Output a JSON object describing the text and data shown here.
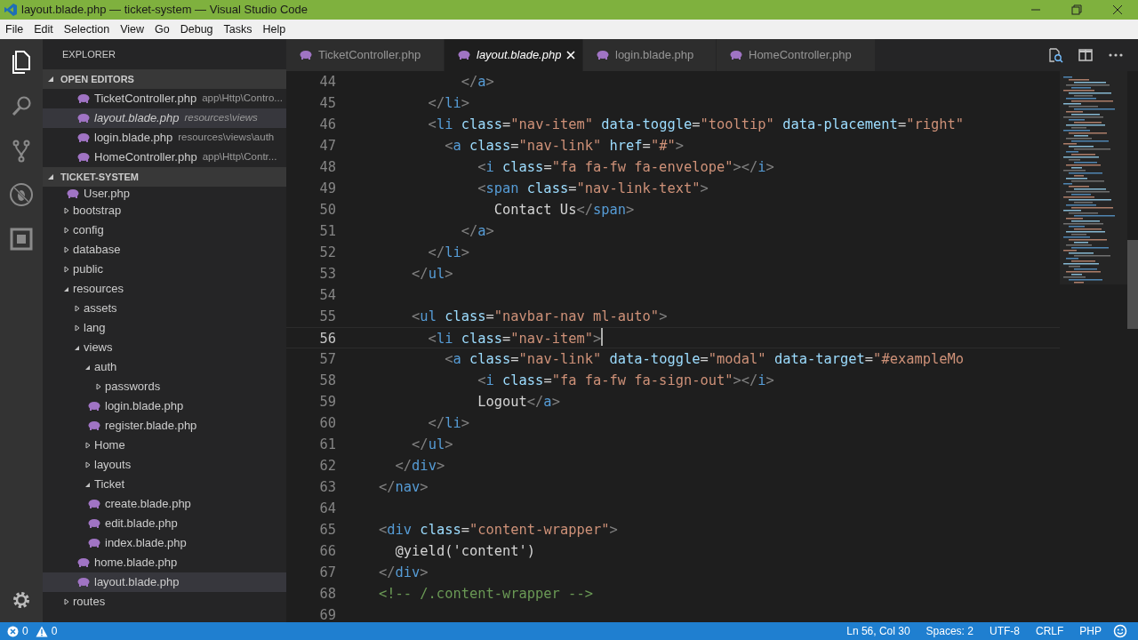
{
  "window": {
    "title": "layout.blade.php — ticket-system — Visual Studio Code"
  },
  "menu": [
    "File",
    "Edit",
    "Selection",
    "View",
    "Go",
    "Debug",
    "Tasks",
    "Help"
  ],
  "activity_bar": [
    {
      "kind": "files",
      "selected": true
    },
    {
      "kind": "search",
      "selected": false
    },
    {
      "kind": "git",
      "selected": false
    },
    {
      "kind": "debug",
      "selected": false
    },
    {
      "kind": "extensions",
      "selected": false
    }
  ],
  "sidebar": {
    "title": "EXPLORER",
    "open_editors": {
      "title": "OPEN EDITORS",
      "expanded": true,
      "items": [
        {
          "name": "TicketController.php",
          "description": "app\\Http\\Contro...",
          "selected": false,
          "preview": false
        },
        {
          "name": "layout.blade.php",
          "description": "resources\\views",
          "selected": true,
          "preview": true
        },
        {
          "name": "login.blade.php",
          "description": "resources\\views\\auth",
          "selected": false,
          "preview": false
        },
        {
          "name": "HomeController.php",
          "description": "app\\Http\\Contr...",
          "selected": false,
          "preview": false
        }
      ]
    },
    "project": {
      "title": "TICKET-SYSTEM",
      "expanded": true,
      "partial_item": "User.php",
      "tree": [
        {
          "name": "bootstrap",
          "kind": "folder",
          "expanded": false,
          "selected": false
        },
        {
          "name": "config",
          "kind": "folder",
          "expanded": false,
          "selected": false
        },
        {
          "name": "database",
          "kind": "folder",
          "expanded": false,
          "selected": false
        },
        {
          "name": "public",
          "kind": "folder",
          "expanded": false,
          "selected": false
        },
        {
          "name": "resources",
          "kind": "folder",
          "expanded": true,
          "selected": false,
          "children": [
            {
              "name": "assets",
              "kind": "folder",
              "expanded": false,
              "selected": false
            },
            {
              "name": "lang",
              "kind": "folder",
              "expanded": false,
              "selected": false
            },
            {
              "name": "views",
              "kind": "folder",
              "expanded": true,
              "selected": false,
              "children": [
                {
                  "name": "auth",
                  "kind": "folder",
                  "expanded": true,
                  "selected": false,
                  "children": [
                    {
                      "name": "passwords",
                      "kind": "folder",
                      "expanded": false,
                      "selected": false
                    },
                    {
                      "name": "login.blade.php",
                      "kind": "file",
                      "selected": false
                    },
                    {
                      "name": "register.blade.php",
                      "kind": "file",
                      "selected": false
                    }
                  ]
                },
                {
                  "name": "Home",
                  "kind": "folder",
                  "expanded": false,
                  "selected": false
                },
                {
                  "name": "layouts",
                  "kind": "folder",
                  "expanded": false,
                  "selected": false
                },
                {
                  "name": "Ticket",
                  "kind": "folder",
                  "expanded": true,
                  "selected": false,
                  "children": [
                    {
                      "name": "create.blade.php",
                      "kind": "file",
                      "selected": false
                    },
                    {
                      "name": "edit.blade.php",
                      "kind": "file",
                      "selected": false
                    },
                    {
                      "name": "index.blade.php",
                      "kind": "file",
                      "selected": false
                    }
                  ]
                },
                {
                  "name": "home.blade.php",
                  "kind": "file",
                  "selected": false
                },
                {
                  "name": "layout.blade.php",
                  "kind": "file",
                  "selected": true
                }
              ]
            }
          ]
        },
        {
          "name": "routes",
          "kind": "folder",
          "expanded": false,
          "selected": false
        }
      ]
    }
  },
  "tabs": [
    {
      "label": "TicketController.php",
      "selected": false,
      "preview": false
    },
    {
      "label": "layout.blade.php",
      "selected": true,
      "preview": true
    },
    {
      "label": "login.blade.php",
      "selected": false,
      "preview": false
    },
    {
      "label": "HomeController.php",
      "selected": false,
      "preview": false
    }
  ],
  "editor": {
    "lines": [
      {
        "number": "44",
        "cursor": false,
        "tokens": [
          {
            "kind": "punct",
            "text": "          </"
          },
          {
            "kind": "tag",
            "text": "a"
          },
          {
            "kind": "punct",
            "text": ">"
          }
        ]
      },
      {
        "number": "45",
        "cursor": false,
        "tokens": [
          {
            "kind": "punct",
            "text": "      </"
          },
          {
            "kind": "tag",
            "text": "li"
          },
          {
            "kind": "punct",
            "text": ">"
          }
        ]
      },
      {
        "number": "46",
        "cursor": false,
        "tokens": [
          {
            "kind": "punct",
            "text": "      <"
          },
          {
            "kind": "tag",
            "text": "li"
          },
          {
            "kind": "attr",
            "text": " class"
          },
          {
            "kind": "text",
            "text": "="
          },
          {
            "kind": "string",
            "text": "\"nav-item\""
          },
          {
            "kind": "attr",
            "text": " data-toggle"
          },
          {
            "kind": "text",
            "text": "="
          },
          {
            "kind": "string",
            "text": "\"tooltip\""
          },
          {
            "kind": "attr",
            "text": " data-placement"
          },
          {
            "kind": "text",
            "text": "="
          },
          {
            "kind": "string",
            "text": "\"right\""
          }
        ]
      },
      {
        "number": "47",
        "cursor": false,
        "tokens": [
          {
            "kind": "punct",
            "text": "        <"
          },
          {
            "kind": "tag",
            "text": "a"
          },
          {
            "kind": "attr",
            "text": " class"
          },
          {
            "kind": "text",
            "text": "="
          },
          {
            "kind": "string",
            "text": "\"nav-link\""
          },
          {
            "kind": "attr",
            "text": " href"
          },
          {
            "kind": "text",
            "text": "="
          },
          {
            "kind": "string",
            "text": "\"#\""
          },
          {
            "kind": "punct",
            "text": ">"
          }
        ]
      },
      {
        "number": "48",
        "cursor": false,
        "tokens": [
          {
            "kind": "punct",
            "text": "            <"
          },
          {
            "kind": "tag",
            "text": "i"
          },
          {
            "kind": "attr",
            "text": " class"
          },
          {
            "kind": "text",
            "text": "="
          },
          {
            "kind": "string",
            "text": "\"fa fa-fw fa-envelope\""
          },
          {
            "kind": "punct",
            "text": "></"
          },
          {
            "kind": "tag",
            "text": "i"
          },
          {
            "kind": "punct",
            "text": ">"
          }
        ]
      },
      {
        "number": "49",
        "cursor": false,
        "tokens": [
          {
            "kind": "punct",
            "text": "            <"
          },
          {
            "kind": "tag",
            "text": "span"
          },
          {
            "kind": "attr",
            "text": " class"
          },
          {
            "kind": "text",
            "text": "="
          },
          {
            "kind": "string",
            "text": "\"nav-link-text\""
          },
          {
            "kind": "punct",
            "text": ">"
          }
        ]
      },
      {
        "number": "50",
        "cursor": false,
        "tokens": [
          {
            "kind": "text",
            "text": "              Contact Us"
          },
          {
            "kind": "punct",
            "text": "</"
          },
          {
            "kind": "tag",
            "text": "span"
          },
          {
            "kind": "punct",
            "text": ">"
          }
        ]
      },
      {
        "number": "51",
        "cursor": false,
        "tokens": [
          {
            "kind": "punct",
            "text": "          </"
          },
          {
            "kind": "tag",
            "text": "a"
          },
          {
            "kind": "punct",
            "text": ">"
          }
        ]
      },
      {
        "number": "52",
        "cursor": false,
        "tokens": [
          {
            "kind": "punct",
            "text": "      </"
          },
          {
            "kind": "tag",
            "text": "li"
          },
          {
            "kind": "punct",
            "text": ">"
          }
        ]
      },
      {
        "number": "53",
        "cursor": false,
        "tokens": [
          {
            "kind": "punct",
            "text": "    </"
          },
          {
            "kind": "tag",
            "text": "ul"
          },
          {
            "kind": "punct",
            "text": ">"
          }
        ]
      },
      {
        "number": "54",
        "cursor": false
      },
      {
        "number": "55",
        "cursor": false,
        "tokens": [
          {
            "kind": "punct",
            "text": "    <"
          },
          {
            "kind": "tag",
            "text": "ul"
          },
          {
            "kind": "attr",
            "text": " class"
          },
          {
            "kind": "text",
            "text": "="
          },
          {
            "kind": "string",
            "text": "\"navbar-nav ml-auto\""
          },
          {
            "kind": "punct",
            "text": ">"
          }
        ]
      },
      {
        "number": "56",
        "cursor": true,
        "tokens": [
          {
            "kind": "punct",
            "text": "      <"
          },
          {
            "kind": "tag",
            "text": "li"
          },
          {
            "kind": "attr",
            "text": " class"
          },
          {
            "kind": "text",
            "text": "="
          },
          {
            "kind": "string",
            "text": "\"nav-item\""
          },
          {
            "kind": "punct",
            "text": ">"
          }
        ]
      },
      {
        "number": "57",
        "cursor": false,
        "tokens": [
          {
            "kind": "punct",
            "text": "        <"
          },
          {
            "kind": "tag",
            "text": "a"
          },
          {
            "kind": "attr",
            "text": " class"
          },
          {
            "kind": "text",
            "text": "="
          },
          {
            "kind": "string",
            "text": "\"nav-link\""
          },
          {
            "kind": "attr",
            "text": " data-toggle"
          },
          {
            "kind": "text",
            "text": "="
          },
          {
            "kind": "string",
            "text": "\"modal\""
          },
          {
            "kind": "attr",
            "text": " data-target"
          },
          {
            "kind": "text",
            "text": "="
          },
          {
            "kind": "string",
            "text": "\"#exampleMo"
          }
        ]
      },
      {
        "number": "58",
        "cursor": false,
        "tokens": [
          {
            "kind": "punct",
            "text": "            <"
          },
          {
            "kind": "tag",
            "text": "i"
          },
          {
            "kind": "attr",
            "text": " class"
          },
          {
            "kind": "text",
            "text": "="
          },
          {
            "kind": "string",
            "text": "\"fa fa-fw fa-sign-out\""
          },
          {
            "kind": "punct",
            "text": "></"
          },
          {
            "kind": "tag",
            "text": "i"
          },
          {
            "kind": "punct",
            "text": ">"
          }
        ]
      },
      {
        "number": "59",
        "cursor": false,
        "tokens": [
          {
            "kind": "text",
            "text": "            Logout"
          },
          {
            "kind": "punct",
            "text": "</"
          },
          {
            "kind": "tag",
            "text": "a"
          },
          {
            "kind": "punct",
            "text": ">"
          }
        ]
      },
      {
        "number": "60",
        "cursor": false,
        "tokens": [
          {
            "kind": "punct",
            "text": "      </"
          },
          {
            "kind": "tag",
            "text": "li"
          },
          {
            "kind": "punct",
            "text": ">"
          }
        ]
      },
      {
        "number": "61",
        "cursor": false,
        "tokens": [
          {
            "kind": "punct",
            "text": "    </"
          },
          {
            "kind": "tag",
            "text": "ul"
          },
          {
            "kind": "punct",
            "text": ">"
          }
        ]
      },
      {
        "number": "62",
        "cursor": false,
        "tokens": [
          {
            "kind": "punct",
            "text": "  </"
          },
          {
            "kind": "tag",
            "text": "div"
          },
          {
            "kind": "punct",
            "text": ">"
          }
        ]
      },
      {
        "number": "63",
        "cursor": false,
        "tokens": [
          {
            "kind": "punct",
            "text": "</"
          },
          {
            "kind": "tag",
            "text": "nav"
          },
          {
            "kind": "punct",
            "text": ">"
          }
        ]
      },
      {
        "number": "64",
        "cursor": false
      },
      {
        "number": "65",
        "cursor": false,
        "tokens": [
          {
            "kind": "punct",
            "text": "<"
          },
          {
            "kind": "tag",
            "text": "div"
          },
          {
            "kind": "attr",
            "text": " class"
          },
          {
            "kind": "text",
            "text": "="
          },
          {
            "kind": "string",
            "text": "\"content-wrapper\""
          },
          {
            "kind": "punct",
            "text": ">"
          }
        ]
      },
      {
        "number": "66",
        "cursor": false,
        "tokens": [
          {
            "kind": "text",
            "text": "  @yield('content')"
          }
        ]
      },
      {
        "number": "67",
        "cursor": false,
        "tokens": [
          {
            "kind": "punct",
            "text": "</"
          },
          {
            "kind": "tag",
            "text": "div"
          },
          {
            "kind": "punct",
            "text": ">"
          }
        ]
      },
      {
        "number": "68",
        "cursor": false,
        "tokens": [
          {
            "kind": "comment",
            "text": "<!-- /.content-wrapper -->"
          }
        ]
      },
      {
        "number": "69",
        "cursor": false
      }
    ]
  },
  "status_bar": {
    "errors": "0",
    "warnings": "0",
    "items": [
      "Ln 56, Col 30",
      "Spaces: 2",
      "UTF-8",
      "CRLF",
      "PHP"
    ]
  }
}
